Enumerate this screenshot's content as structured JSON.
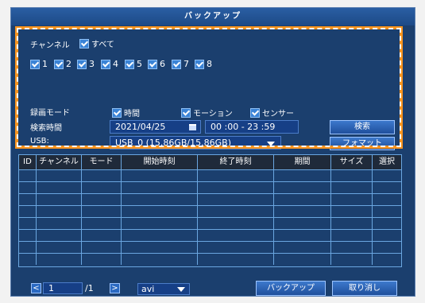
{
  "title": "バックアップ",
  "channel_label": "チャンネル",
  "all_label": "すべて",
  "channels": [
    "1",
    "2",
    "3",
    "4",
    "5",
    "6",
    "7",
    "8"
  ],
  "record_mode_label": "録画モード",
  "modes": [
    "時間",
    "モーション",
    "センサー"
  ],
  "search_time_label": "検索時間",
  "date_value": "2021/04/25",
  "time_range": "00 :00 - 23 :59",
  "search_button": "検索",
  "usb_label": "USB:",
  "usb_value": "USB_0 (15.86GB/15.86GB)",
  "format_button": "フォマット",
  "columns": [
    "ID",
    "チャンネル",
    "モード",
    "開始時刻",
    "終了時刻",
    "期間",
    "サイズ",
    "選択"
  ],
  "page_current": "1",
  "page_total": "/1",
  "file_type": "avi",
  "backup_button": "バックアップ",
  "cancel_button": "取り消し"
}
